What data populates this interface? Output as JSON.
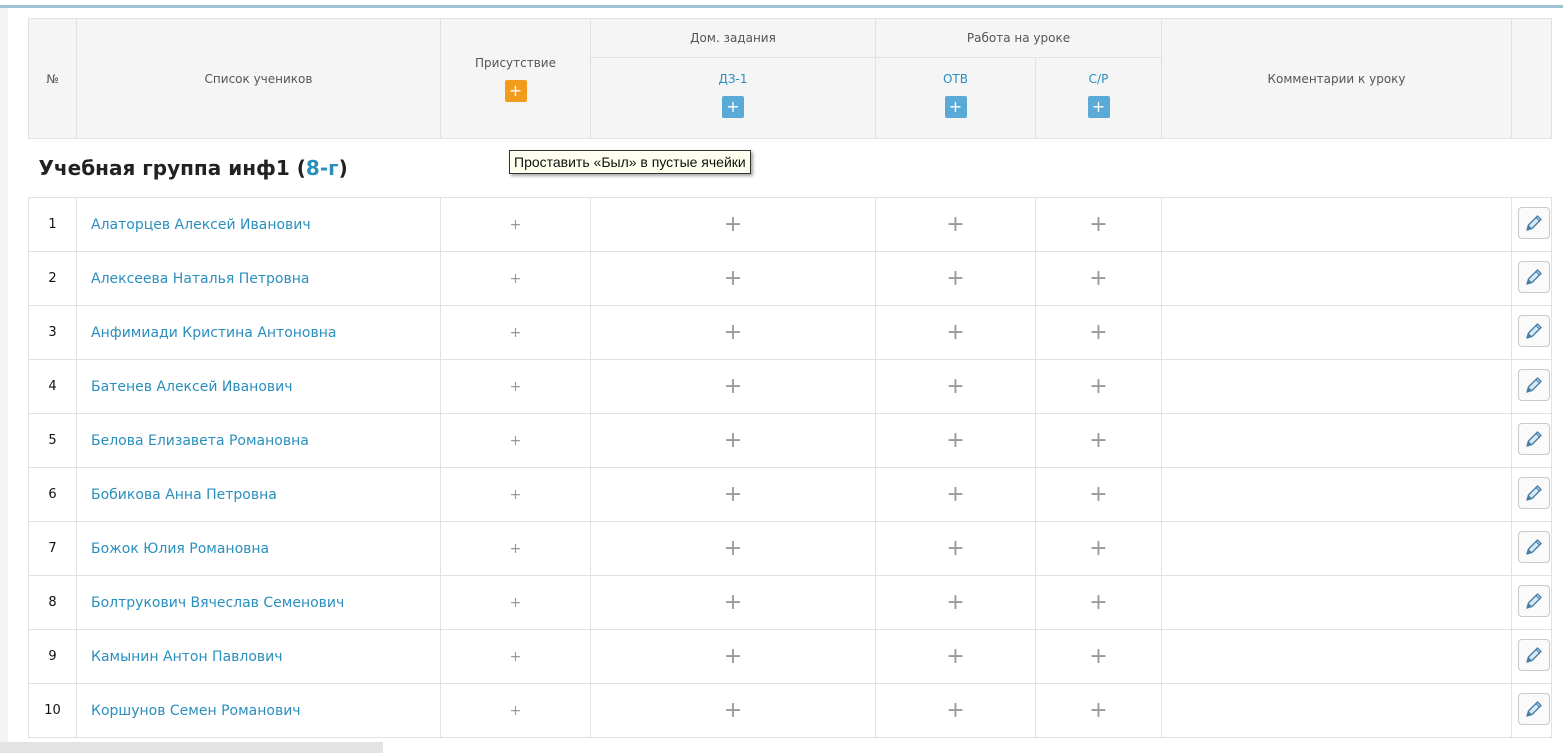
{
  "colors": {
    "link": "#2a8fbd",
    "attendance_button": "#f29b1c",
    "grade_button": "#5aaad8",
    "header_bg": "#f5f5f5",
    "border": "#dfe3e6"
  },
  "table": {
    "headers": {
      "number": "№",
      "students": "Список учеников",
      "attendance": "Присутствие",
      "homework": "Дом. задания",
      "classwork": "Работа на уроке",
      "comments": "Комментарии к уроку"
    },
    "subheaders": {
      "hw1": "ДЗ-1",
      "otv": "ОТВ",
      "sr": "С/Р"
    },
    "add_glyph": "+",
    "cell_glyph": "+"
  },
  "group": {
    "title": "Учебная группа инф1",
    "open_paren": "(",
    "code": "8-г",
    "close_paren": ")"
  },
  "tooltip": "Проставить «Был» в пустые ячейки",
  "students": [
    {
      "num": "1",
      "name": "Алаторцев Алексей Иванович"
    },
    {
      "num": "2",
      "name": "Алексеева Наталья Петровна"
    },
    {
      "num": "3",
      "name": "Анфимиади Кристина Антоновна"
    },
    {
      "num": "4",
      "name": "Батенев Алексей Иванович"
    },
    {
      "num": "5",
      "name": "Белова Елизавета Романовна"
    },
    {
      "num": "6",
      "name": "Бобикова Анна Петровна"
    },
    {
      "num": "7",
      "name": "Божок Юлия Романовна"
    },
    {
      "num": "8",
      "name": "Болтрукович Вячеслав Семенович"
    },
    {
      "num": "9",
      "name": "Камынин Антон Павлович"
    },
    {
      "num": "10",
      "name": "Коршунов Семен Романович"
    }
  ],
  "icons": {
    "edit": "pencil-icon"
  }
}
